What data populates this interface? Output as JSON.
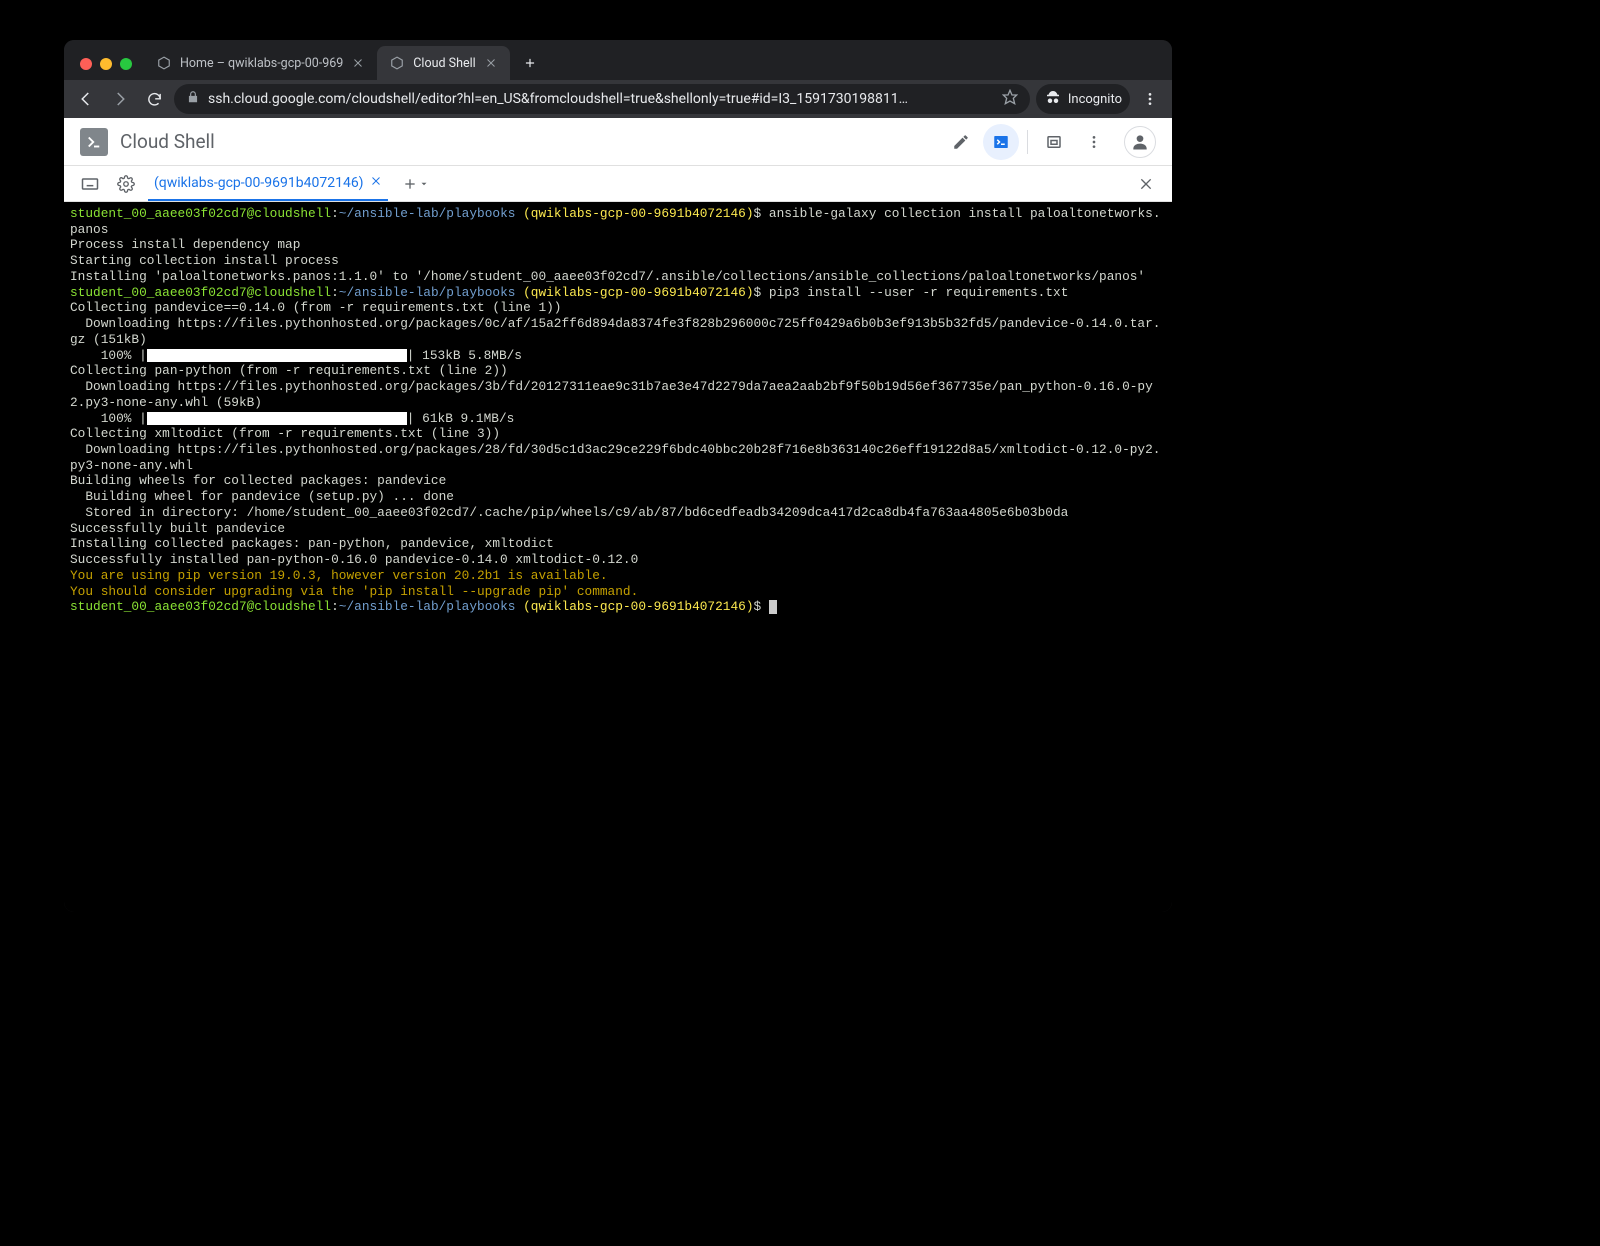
{
  "browser": {
    "tabs": [
      {
        "label": "Home – qwiklabs-gcp-00-969",
        "active": false
      },
      {
        "label": "Cloud Shell",
        "active": true
      }
    ],
    "url": "ssh.cloud.google.com/cloudshell/editor?hl=en_US&fromcloudshell=true&shellonly=true#id=I3_1591730198811…",
    "incognito_label": "Incognito"
  },
  "cloudshell": {
    "title": "Cloud Shell",
    "term_tab_label": "(qwiklabs-gcp-00-9691b4072146)"
  },
  "prompt": {
    "user": "student_00_aaee03f02cd7@cloudshell",
    "colon": ":",
    "path": "~/ansible-lab/playbooks",
    "project": "(qwiklabs-gcp-00-9691b4072146)",
    "dollar": "$"
  },
  "cmds": {
    "c1": "ansible-galaxy collection install paloaltonetworks.panos",
    "c2": "pip3 install --user -r requirements.txt"
  },
  "out": {
    "l1": "Process install dependency map",
    "l2": "Starting collection install process",
    "l3": "Installing 'paloaltonetworks.panos:1.1.0' to '/home/student_00_aaee03f02cd7/.ansible/collections/ansible_collections/paloaltonetworks/panos'",
    "l4": "Collecting pandevice==0.14.0 (from -r requirements.txt (line 1))",
    "l5": "  Downloading https://files.pythonhosted.org/packages/0c/af/15a2ff6d894da8374fe3f828b296000c725ff0429a6b0b3ef913b5b32fd5/pandevice-0.14.0.tar.gz (151kB)",
    "p1_left": "    100% |",
    "p1_right": "| 153kB 5.8MB/s",
    "l6": "Collecting pan-python (from -r requirements.txt (line 2))",
    "l7": "  Downloading https://files.pythonhosted.org/packages/3b/fd/20127311eae9c31b7ae3e47d2279da7aea2aab2bf9f50b19d56ef367735e/pan_python-0.16.0-py2.py3-none-any.whl (59kB)",
    "p2_left": "    100% |",
    "p2_right": "| 61kB 9.1MB/s",
    "l8": "Collecting xmltodict (from -r requirements.txt (line 3))",
    "l9": "  Downloading https://files.pythonhosted.org/packages/28/fd/30d5c1d3ac29ce229f6bdc40bbc20b28f716e8b363140c26eff19122d8a5/xmltodict-0.12.0-py2.py3-none-any.whl",
    "l10": "Building wheels for collected packages: pandevice",
    "l11": "  Building wheel for pandevice (setup.py) ... done",
    "l12": "  Stored in directory: /home/student_00_aaee03f02cd7/.cache/pip/wheels/c9/ab/87/bd6cedfeadb34209dca417d2ca8db4fa763aa4805e6b03b0da",
    "l13": "Successfully built pandevice",
    "l14": "Installing collected packages: pan-python, pandevice, xmltodict",
    "l15": "Successfully installed pan-python-0.16.0 pandevice-0.14.0 xmltodict-0.12.0",
    "w1": "You are using pip version 19.0.3, however version 20.2b1 is available.",
    "w2": "You should consider upgrading via the 'pip install --upgrade pip' command."
  }
}
